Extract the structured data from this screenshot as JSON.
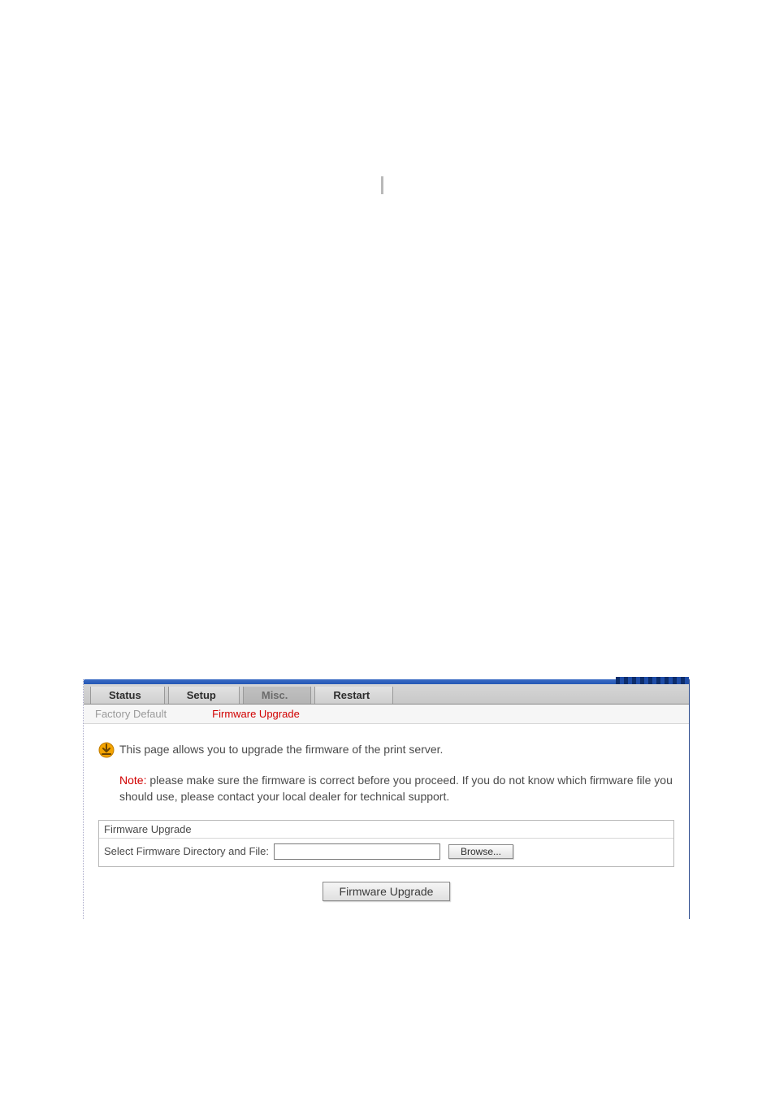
{
  "tabs": {
    "status": "Status",
    "setup": "Setup",
    "misc": "Misc.",
    "restart": "Restart"
  },
  "subtabs": {
    "factory_default": "Factory Default",
    "firmware_upgrade": "Firmware Upgrade"
  },
  "info": {
    "text": "This page allows you to upgrade the firmware of the print server."
  },
  "note": {
    "label": "Note:",
    "text": " please make sure the firmware is correct before you proceed. If you do not know which firmware file you should use, please contact your local dealer for technical support."
  },
  "fieldset": {
    "title": "Firmware Upgrade",
    "label": "Select Firmware Directory and File:",
    "file_value": "",
    "browse_label": "Browse..."
  },
  "submit": {
    "label": "Firmware Upgrade"
  },
  "colors": {
    "accent_red": "#d10000",
    "tab_blue": "#2457b5"
  }
}
